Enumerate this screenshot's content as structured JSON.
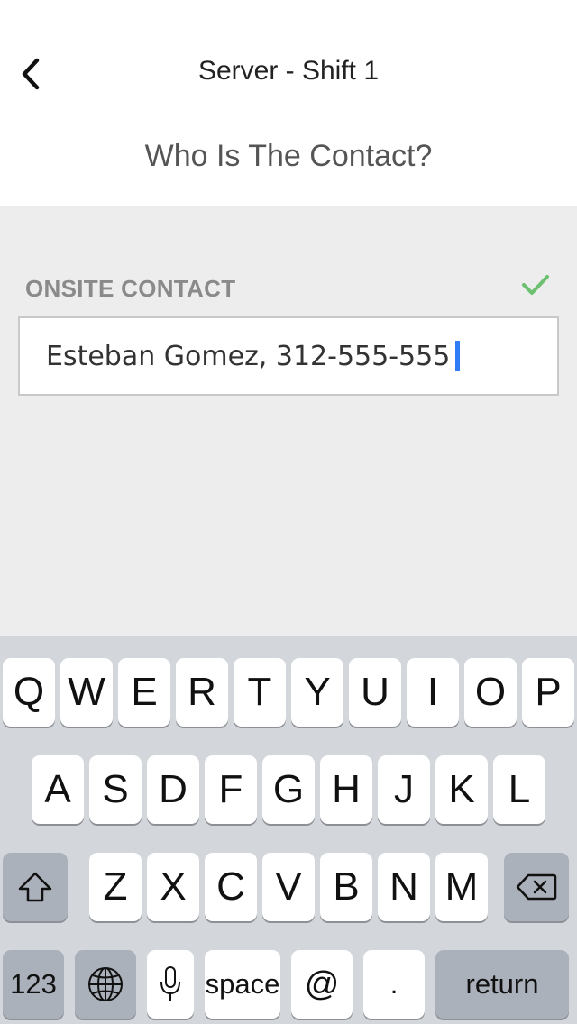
{
  "header": {
    "back_icon": "chevron-left-icon",
    "title": "Server - Shift 1",
    "question": "Who Is The Contact?"
  },
  "form": {
    "label": "ONSITE CONTACT",
    "valid_icon": "checkmark-icon",
    "valid_color": "#6cc070",
    "value": "Esteban Gomez, 312-555-555",
    "caret_color": "#2f7cf6"
  },
  "keyboard": {
    "row1": [
      "Q",
      "W",
      "E",
      "R",
      "T",
      "Y",
      "U",
      "I",
      "O",
      "P"
    ],
    "row2": [
      "A",
      "S",
      "D",
      "F",
      "G",
      "H",
      "J",
      "K",
      "L"
    ],
    "row3": [
      "Z",
      "X",
      "C",
      "V",
      "B",
      "N",
      "M"
    ],
    "shift_icon": "shift-icon",
    "delete_icon": "backspace-icon",
    "numbers_label": "123",
    "globe_icon": "globe-icon",
    "mic_icon": "microphone-icon",
    "space_label": "space",
    "at_label": "@",
    "period_label": ".",
    "return_label": "return"
  }
}
